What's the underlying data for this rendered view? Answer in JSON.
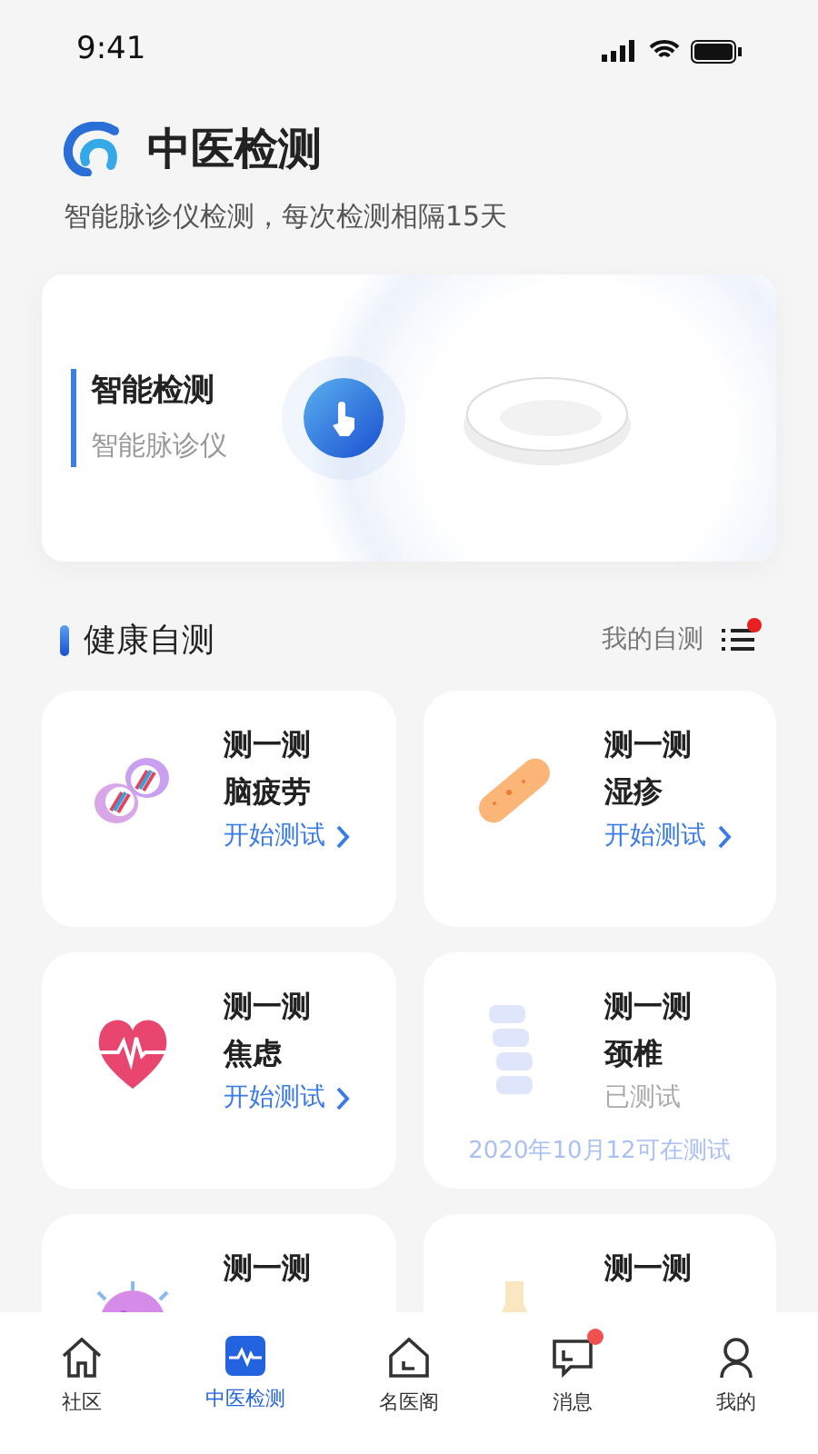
{
  "status_bar": {
    "time": "9:41"
  },
  "header": {
    "title": "中医检测",
    "subtitle": "智能脉诊仪检测，每次检测相隔15天"
  },
  "banner": {
    "title": "智能检测",
    "subtitle": "智能脉诊仪"
  },
  "section": {
    "title": "健康自测",
    "link": "我的自测",
    "badge": true
  },
  "cards": [
    {
      "kind": "start",
      "title": "测一测",
      "name": "脑疲劳",
      "action": "开始测试"
    },
    {
      "kind": "start",
      "title": "测一测",
      "name": "湿疹",
      "action": "开始测试"
    },
    {
      "kind": "start",
      "title": "测一测",
      "name": "焦虑",
      "action": "开始测试"
    },
    {
      "kind": "done",
      "title": "测一测",
      "name": "颈椎",
      "status": "已测试",
      "note": "2020年10月12可在测试"
    },
    {
      "kind": "cut",
      "title": "测一测"
    },
    {
      "kind": "cut",
      "title": "测一测"
    }
  ],
  "tab_bar": [
    {
      "label": "社区",
      "selected": false,
      "badge": false
    },
    {
      "label": "中医检测",
      "selected": true,
      "badge": false
    },
    {
      "label": "名医阁",
      "selected": false,
      "badge": false
    },
    {
      "label": "消息",
      "selected": false,
      "badge": true
    },
    {
      "label": "我的",
      "selected": false,
      "badge": false
    }
  ]
}
